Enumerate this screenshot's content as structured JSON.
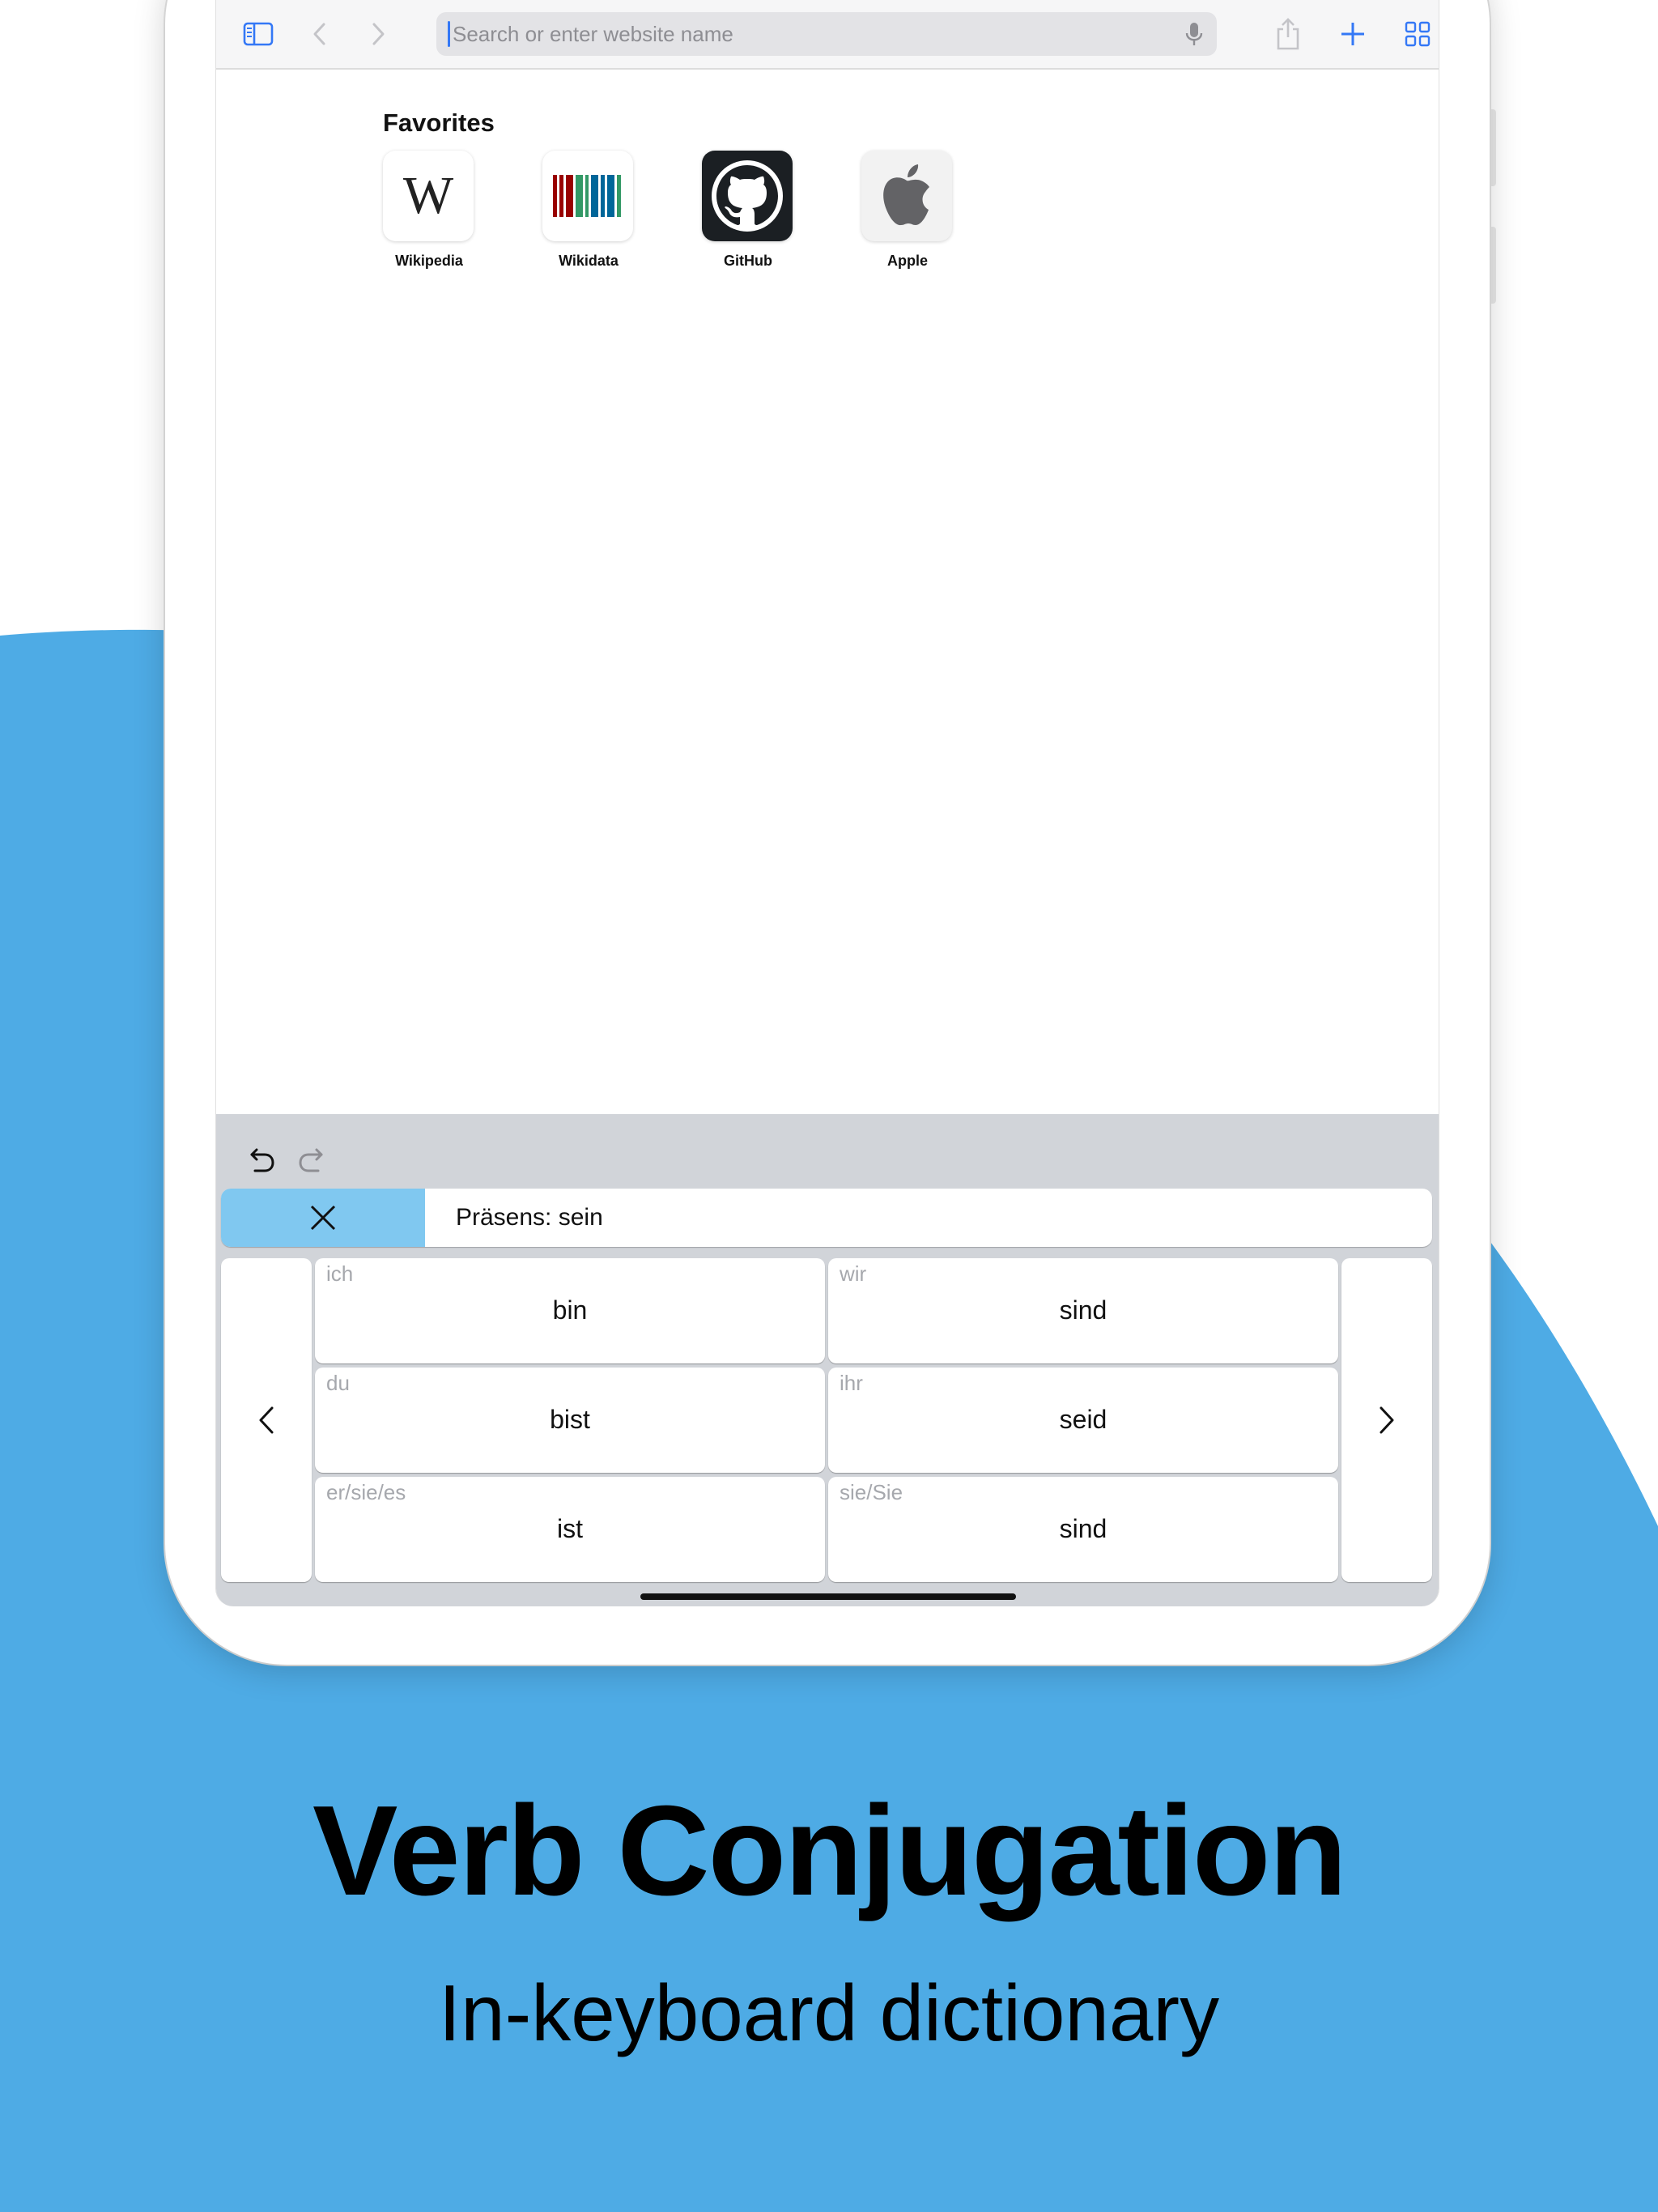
{
  "colors": {
    "background_blue": "#4eabe5",
    "banner_close_blue": "#80c8f0",
    "accent": "#3478f6"
  },
  "browser": {
    "url_placeholder": "Search or enter website name",
    "icons": [
      "sidebar-icon",
      "back-icon",
      "forward-icon",
      "microphone-icon",
      "share-icon",
      "new-tab-icon",
      "tabs-grid-icon"
    ]
  },
  "favorites": {
    "title": "Favorites",
    "items": [
      {
        "label": "Wikipedia",
        "icon": "wikipedia-logo"
      },
      {
        "label": "Wikidata",
        "icon": "wikidata-logo"
      },
      {
        "label": "GitHub",
        "icon": "github-logo"
      },
      {
        "label": "Apple",
        "icon": "apple-logo"
      }
    ]
  },
  "keyboard": {
    "banner_title": "Präsens: sein",
    "icons": [
      "undo-icon",
      "redo-icon",
      "close-icon",
      "chevron-left-icon",
      "chevron-right-icon"
    ],
    "conjugations": [
      {
        "pronoun": "ich",
        "form": "bin"
      },
      {
        "pronoun": "wir",
        "form": "sind"
      },
      {
        "pronoun": "du",
        "form": "bist"
      },
      {
        "pronoun": "ihr",
        "form": "seid"
      },
      {
        "pronoun": "er/sie/es",
        "form": "ist"
      },
      {
        "pronoun": "sie/Sie",
        "form": "sind"
      }
    ]
  },
  "caption": {
    "headline": "Verb Conjugation",
    "subline": "In-keyboard dictionary"
  }
}
